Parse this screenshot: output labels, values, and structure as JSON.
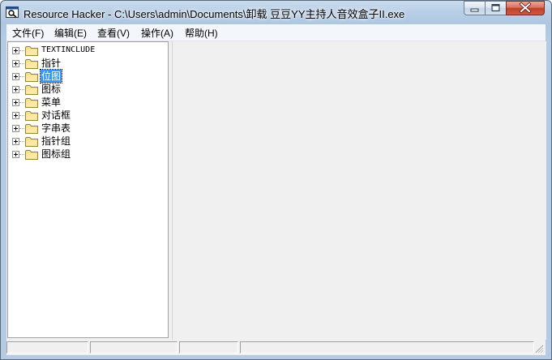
{
  "window": {
    "title": "Resource Hacker  -  C:\\Users\\admin\\Documents\\卸载 豆豆YY主持人音效盒子II.exe",
    "icon": "resource-hacker-icon"
  },
  "caption_buttons": {
    "minimize": "minimize-icon",
    "maximize": "maximize-icon",
    "close": "close-icon"
  },
  "menu": [
    "文件(F)",
    "编辑(E)",
    "查看(V)",
    "操作(A)",
    "帮助(H)"
  ],
  "tree": {
    "nodes": [
      {
        "label": "TEXTINCLUDE",
        "selected": false
      },
      {
        "label": "指针",
        "selected": false
      },
      {
        "label": "位图",
        "selected": true
      },
      {
        "label": "图标",
        "selected": false
      },
      {
        "label": "菜单",
        "selected": false
      },
      {
        "label": "对话框",
        "selected": false
      },
      {
        "label": "字串表",
        "selected": false
      },
      {
        "label": "指针组",
        "selected": false
      },
      {
        "label": "图标组",
        "selected": false
      }
    ]
  },
  "statusbar": {
    "panels": [
      "",
      "",
      "",
      ""
    ]
  },
  "colors": {
    "selection": "#3399ff",
    "close_button": "#c0402a"
  }
}
